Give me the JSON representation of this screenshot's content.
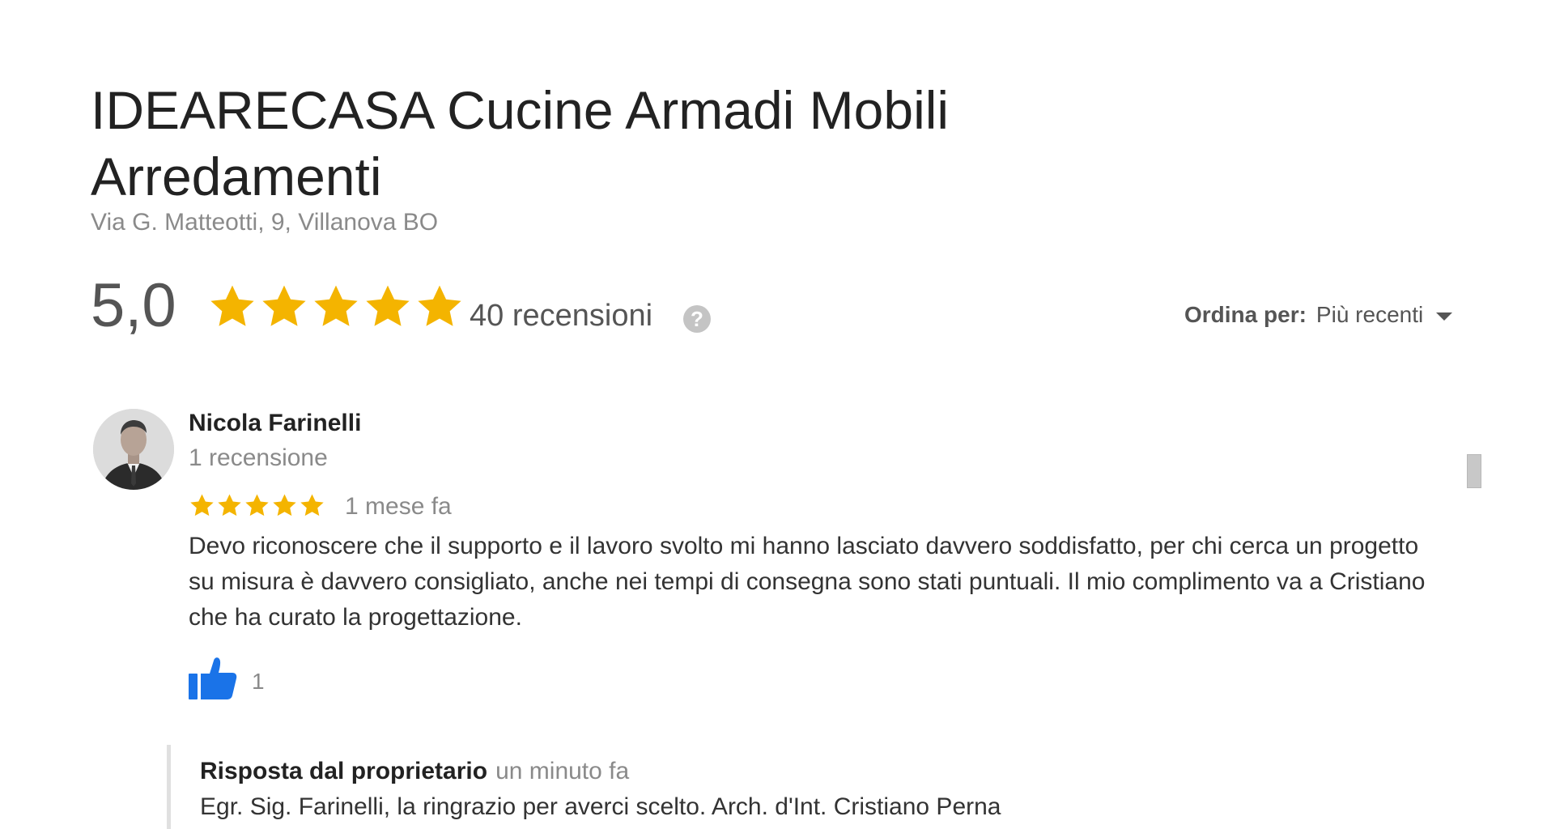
{
  "business": {
    "name": "IDEARECASA Cucine Armadi Mobili Arredamenti",
    "address": "Via G. Matteotti, 9, Villanova BO"
  },
  "summary": {
    "rating": "5,0",
    "stars_filled": 5,
    "review_count": "40 recensioni",
    "help_symbol": "?"
  },
  "sort": {
    "label": "Ordina per:",
    "value": "Più recenti"
  },
  "review": {
    "author": "Nicola Farinelli",
    "author_meta": "1 recensione",
    "stars_filled": 5,
    "time": "1 mese fa",
    "text": "Devo riconoscere che il supporto e il lavoro svolto mi hanno lasciato davvero soddisfatto, per chi cerca un progetto su misura è davvero consigliato, anche nei tempi di consegna sono stati puntuali. Il mio complimento va a Cristiano che ha curato la progettazione.",
    "likes": "1"
  },
  "owner_reply": {
    "label": "Risposta dal proprietario",
    "time": "un minuto fa",
    "text": "Egr. Sig. Farinelli, la ringrazio per averci scelto. Arch. d'Int. Cristiano Perna"
  },
  "colors": {
    "star": "#f4b400",
    "like": "#1a73e8",
    "muted": "#8a8a8a"
  }
}
